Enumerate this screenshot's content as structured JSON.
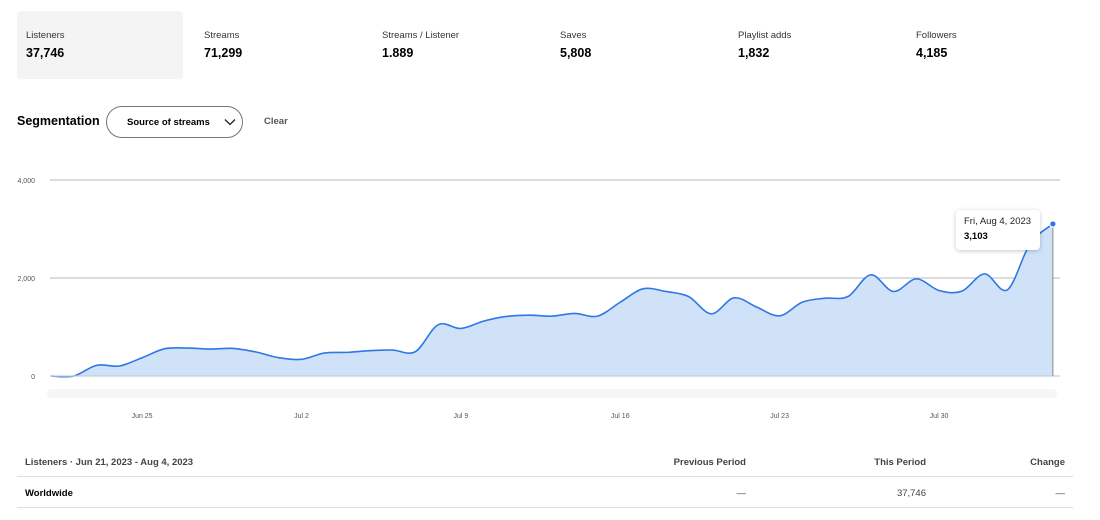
{
  "metrics": [
    {
      "label": "Listeners",
      "value": "37,746",
      "active": true
    },
    {
      "label": "Streams",
      "value": "71,299"
    },
    {
      "label": "Streams / Listener",
      "value": "1.889"
    },
    {
      "label": "Saves",
      "value": "5,808"
    },
    {
      "label": "Playlist adds",
      "value": "1,832"
    },
    {
      "label": "Followers",
      "value": "4,185"
    }
  ],
  "segmentation": {
    "title": "Segmentation",
    "dropdown_value": "Source of streams",
    "dropdown_icon": "chevron-down-icon",
    "clear_label": "Clear"
  },
  "tooltip": {
    "date": "Fri, Aug 4, 2023",
    "value": "3,103"
  },
  "colors": {
    "line": "#2e77e5",
    "fill": "#cfe2f8",
    "grid": "#b8b8b8"
  },
  "chart_data": {
    "type": "area",
    "x_start": "2023-06-21",
    "x_end": "2023-08-04",
    "x_tick_labels": [
      "Jun 25",
      "Jul 2",
      "Jul 9",
      "Jul 16",
      "Jul 23",
      "Jul 30"
    ],
    "y_tick_labels": [
      "0",
      "2,000",
      "4,000"
    ],
    "y_ticks": [
      0,
      2000,
      4000
    ],
    "ylim": [
      0,
      4000
    ],
    "grid": true,
    "values": [
      0,
      0,
      217,
      204,
      373,
      557,
      570,
      550,
      563,
      490,
      373,
      340,
      468,
      482,
      516,
      530,
      496,
      1045,
      970,
      1120,
      1215,
      1242,
      1222,
      1276,
      1222,
      1507,
      1779,
      1725,
      1622,
      1270,
      1595,
      1405,
      1229,
      1507,
      1588,
      1622,
      2064,
      1725,
      1982,
      1745,
      1731,
      2084,
      1758,
      2700,
      3103
    ]
  },
  "table": {
    "headers": [
      "Listeners · Jun 21, 2023 - Aug 4, 2023",
      "Previous Period",
      "This Period",
      "Change"
    ],
    "rows": [
      [
        "Worldwide",
        "—",
        "37,746",
        "—"
      ]
    ]
  }
}
